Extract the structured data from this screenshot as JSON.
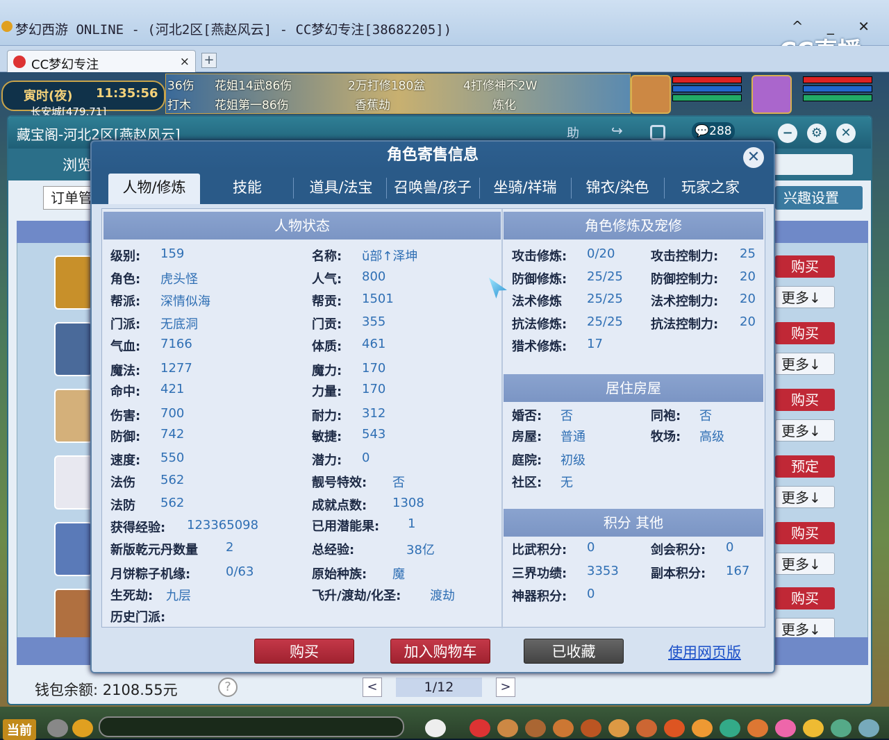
{
  "window": {
    "title": "梦幻西游 ONLINE - (河北2区[燕赵风云] - CC梦幻专注[38682205])",
    "controls": "^ _ ✕",
    "watermark": "CC直播"
  },
  "tabbar": {
    "tab_label": "CC梦幻专注",
    "tab_close": "×",
    "add": "+"
  },
  "hud": {
    "time_label": "寅时(夜)",
    "clock": "11:35:56",
    "location": "长安城[479,71]",
    "banner_lines": [
      "36伤",
      "花姐14武86伤",
      "2万打修180盆",
      "4打修神不2W",
      "打木",
      "花姐第一86伤",
      "香蕉劫",
      "炼化"
    ]
  },
  "cbg": {
    "title": "藏宝阁-河北2区[燕赵风云]",
    "help": "助",
    "message_count": "288",
    "browse": "浏览",
    "orders": "订单管",
    "interest": "兴趣设置",
    "side_buttons": [
      {
        "label": "购买",
        "style": "red"
      },
      {
        "label": "更多↓",
        "style": "white"
      },
      {
        "label": "购买",
        "style": "red"
      },
      {
        "label": "更多↓",
        "style": "white"
      },
      {
        "label": "购买",
        "style": "red"
      },
      {
        "label": "更多↓",
        "style": "white"
      },
      {
        "label": "预定",
        "style": "red"
      },
      {
        "label": "更多↓",
        "style": "white"
      },
      {
        "label": "购买",
        "style": "red"
      },
      {
        "label": "更多↓",
        "style": "white"
      },
      {
        "label": "购买",
        "style": "red"
      },
      {
        "label": "更多↓",
        "style": "white"
      }
    ],
    "wallet": "钱包余额: 2108.55元",
    "help_q": "?",
    "pager": {
      "prev": "<",
      "page": "1/12",
      "next": ">"
    }
  },
  "dialog": {
    "title": "角色寄售信息",
    "close": "✕",
    "tabs": [
      "人物/修炼",
      "技能",
      "道具/法宝",
      "召唤兽/孩子",
      "坐骑/祥瑞",
      "锦衣/染色",
      "玩家之家"
    ],
    "sections": {
      "status": "人物状态",
      "cultivation": "角色修炼及宠修",
      "house": "居住房屋",
      "points": "积分 其他"
    },
    "left_col": [
      {
        "k": "级别:",
        "v": "159"
      },
      {
        "k": "角色:",
        "v": "虎头怪"
      },
      {
        "k": "帮派:",
        "v": "深情似海"
      },
      {
        "k": "门派:",
        "v": "无底洞"
      },
      {
        "k": "气血:",
        "v": "7166"
      },
      {
        "k": "魔法:",
        "v": "1277"
      },
      {
        "k": "命中:",
        "v": "421"
      },
      {
        "k": "伤害:",
        "v": "700"
      },
      {
        "k": "防御:",
        "v": "742"
      },
      {
        "k": "速度:",
        "v": "550"
      },
      {
        "k": "法伤",
        "v": "562"
      },
      {
        "k": "法防",
        "v": "562"
      },
      {
        "k": "获得经验:",
        "v": "123365098"
      },
      {
        "k": "新版乾元丹数量",
        "v": "2"
      },
      {
        "k": "月饼粽子机缘:",
        "v": "0/63"
      },
      {
        "k": "生死劫:",
        "v": "九层"
      },
      {
        "k": "历史门派:",
        "v": ""
      }
    ],
    "mid_col": [
      {
        "k": "名称:",
        "v": "ŭ部↑泽坤"
      },
      {
        "k": "人气:",
        "v": "800"
      },
      {
        "k": "帮贡:",
        "v": "1501"
      },
      {
        "k": "门贡:",
        "v": "355"
      },
      {
        "k": "体质:",
        "v": "461"
      },
      {
        "k": "魔力:",
        "v": "170"
      },
      {
        "k": "力量:",
        "v": "170"
      },
      {
        "k": "耐力:",
        "v": "312"
      },
      {
        "k": "敏捷:",
        "v": "543"
      },
      {
        "k": "潜力:",
        "v": "0"
      },
      {
        "k": "靓号特效:",
        "v": "否"
      },
      {
        "k": "成就点数:",
        "v": "1308"
      },
      {
        "k": "已用潜能果:",
        "v": "1"
      },
      {
        "k": "总经验:",
        "v": "38亿"
      },
      {
        "k": "原始种族:",
        "v": "魔"
      },
      {
        "k": "飞升/渡劫/化圣:",
        "v": "渡劫"
      }
    ],
    "cult_left": [
      {
        "k": "攻击修炼:",
        "v": "0/20"
      },
      {
        "k": "防御修炼:",
        "v": "25/25"
      },
      {
        "k": "法术修炼",
        "v": "25/25"
      },
      {
        "k": "抗法修炼:",
        "v": "25/25"
      },
      {
        "k": "猎术修炼:",
        "v": "17"
      }
    ],
    "cult_right": [
      {
        "k": "攻击控制力:",
        "v": "25"
      },
      {
        "k": "防御控制力:",
        "v": "20"
      },
      {
        "k": "法术控制力:",
        "v": "20"
      },
      {
        "k": "抗法控制力:",
        "v": "20"
      }
    ],
    "house_left": [
      {
        "k": "婚否:",
        "v": "否"
      },
      {
        "k": "房屋:",
        "v": "普通"
      },
      {
        "k": "庭院:",
        "v": "初级"
      },
      {
        "k": "社区:",
        "v": "无"
      }
    ],
    "house_right": [
      {
        "k": "同袍:",
        "v": "否"
      },
      {
        "k": "牧场:",
        "v": "高级"
      }
    ],
    "points_left": [
      {
        "k": "比武积分:",
        "v": "0"
      },
      {
        "k": "三界功绩:",
        "v": "3353"
      },
      {
        "k": "神器积分:",
        "v": "0"
      }
    ],
    "points_right": [
      {
        "k": "剑会积分:",
        "v": "0"
      },
      {
        "k": "副本积分:",
        "v": "167"
      }
    ],
    "buttons": {
      "buy": "购买",
      "cart": "加入购物车",
      "fav": "已收藏",
      "web": "使用网页版"
    }
  },
  "taskbar": {
    "now": "当前"
  }
}
